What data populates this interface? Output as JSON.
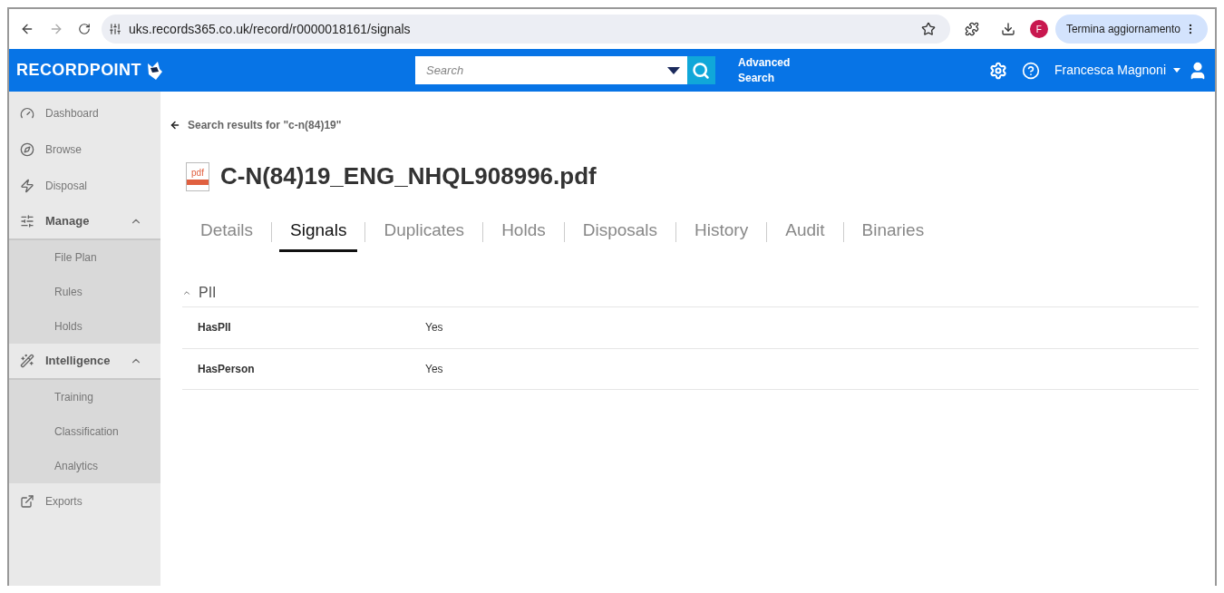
{
  "browser": {
    "url": "uks.records365.co.uk/record/r0000018161/signals",
    "profile_initial": "F",
    "update_button": "Termina aggiornamento"
  },
  "header": {
    "logo": "RECORDPOINT",
    "search": {
      "placeholder": "Search"
    },
    "advanced_search": "Advanced Search",
    "user": "Francesca Magnoni"
  },
  "sidebar": {
    "items": [
      {
        "label": "Dashboard"
      },
      {
        "label": "Browse"
      },
      {
        "label": "Disposal"
      },
      {
        "label": "Manage",
        "expanded": true,
        "children": [
          {
            "label": "File Plan"
          },
          {
            "label": "Rules"
          },
          {
            "label": "Holds"
          }
        ]
      },
      {
        "label": "Intelligence",
        "expanded": true,
        "children": [
          {
            "label": "Training"
          },
          {
            "label": "Classification"
          },
          {
            "label": "Analytics"
          }
        ]
      },
      {
        "label": "Exports"
      }
    ]
  },
  "main": {
    "back_link": "Search results for \"c-n(84)19\"",
    "file_icon_text": "pdf",
    "title": "C-N(84)19_ENG_NHQL908996.pdf",
    "tabs": [
      {
        "label": "Details",
        "selected": false
      },
      {
        "label": "Signals",
        "selected": true
      },
      {
        "label": "Duplicates",
        "selected": false
      },
      {
        "label": "Holds",
        "selected": false
      },
      {
        "label": "Disposals",
        "selected": false
      },
      {
        "label": "History",
        "selected": false
      },
      {
        "label": "Audit",
        "selected": false
      },
      {
        "label": "Binaries",
        "selected": false
      }
    ],
    "section": {
      "title": "PII",
      "expanded": true,
      "rows": [
        {
          "name": "HasPII",
          "value": "Yes"
        },
        {
          "name": "HasPerson",
          "value": "Yes"
        }
      ]
    }
  }
}
